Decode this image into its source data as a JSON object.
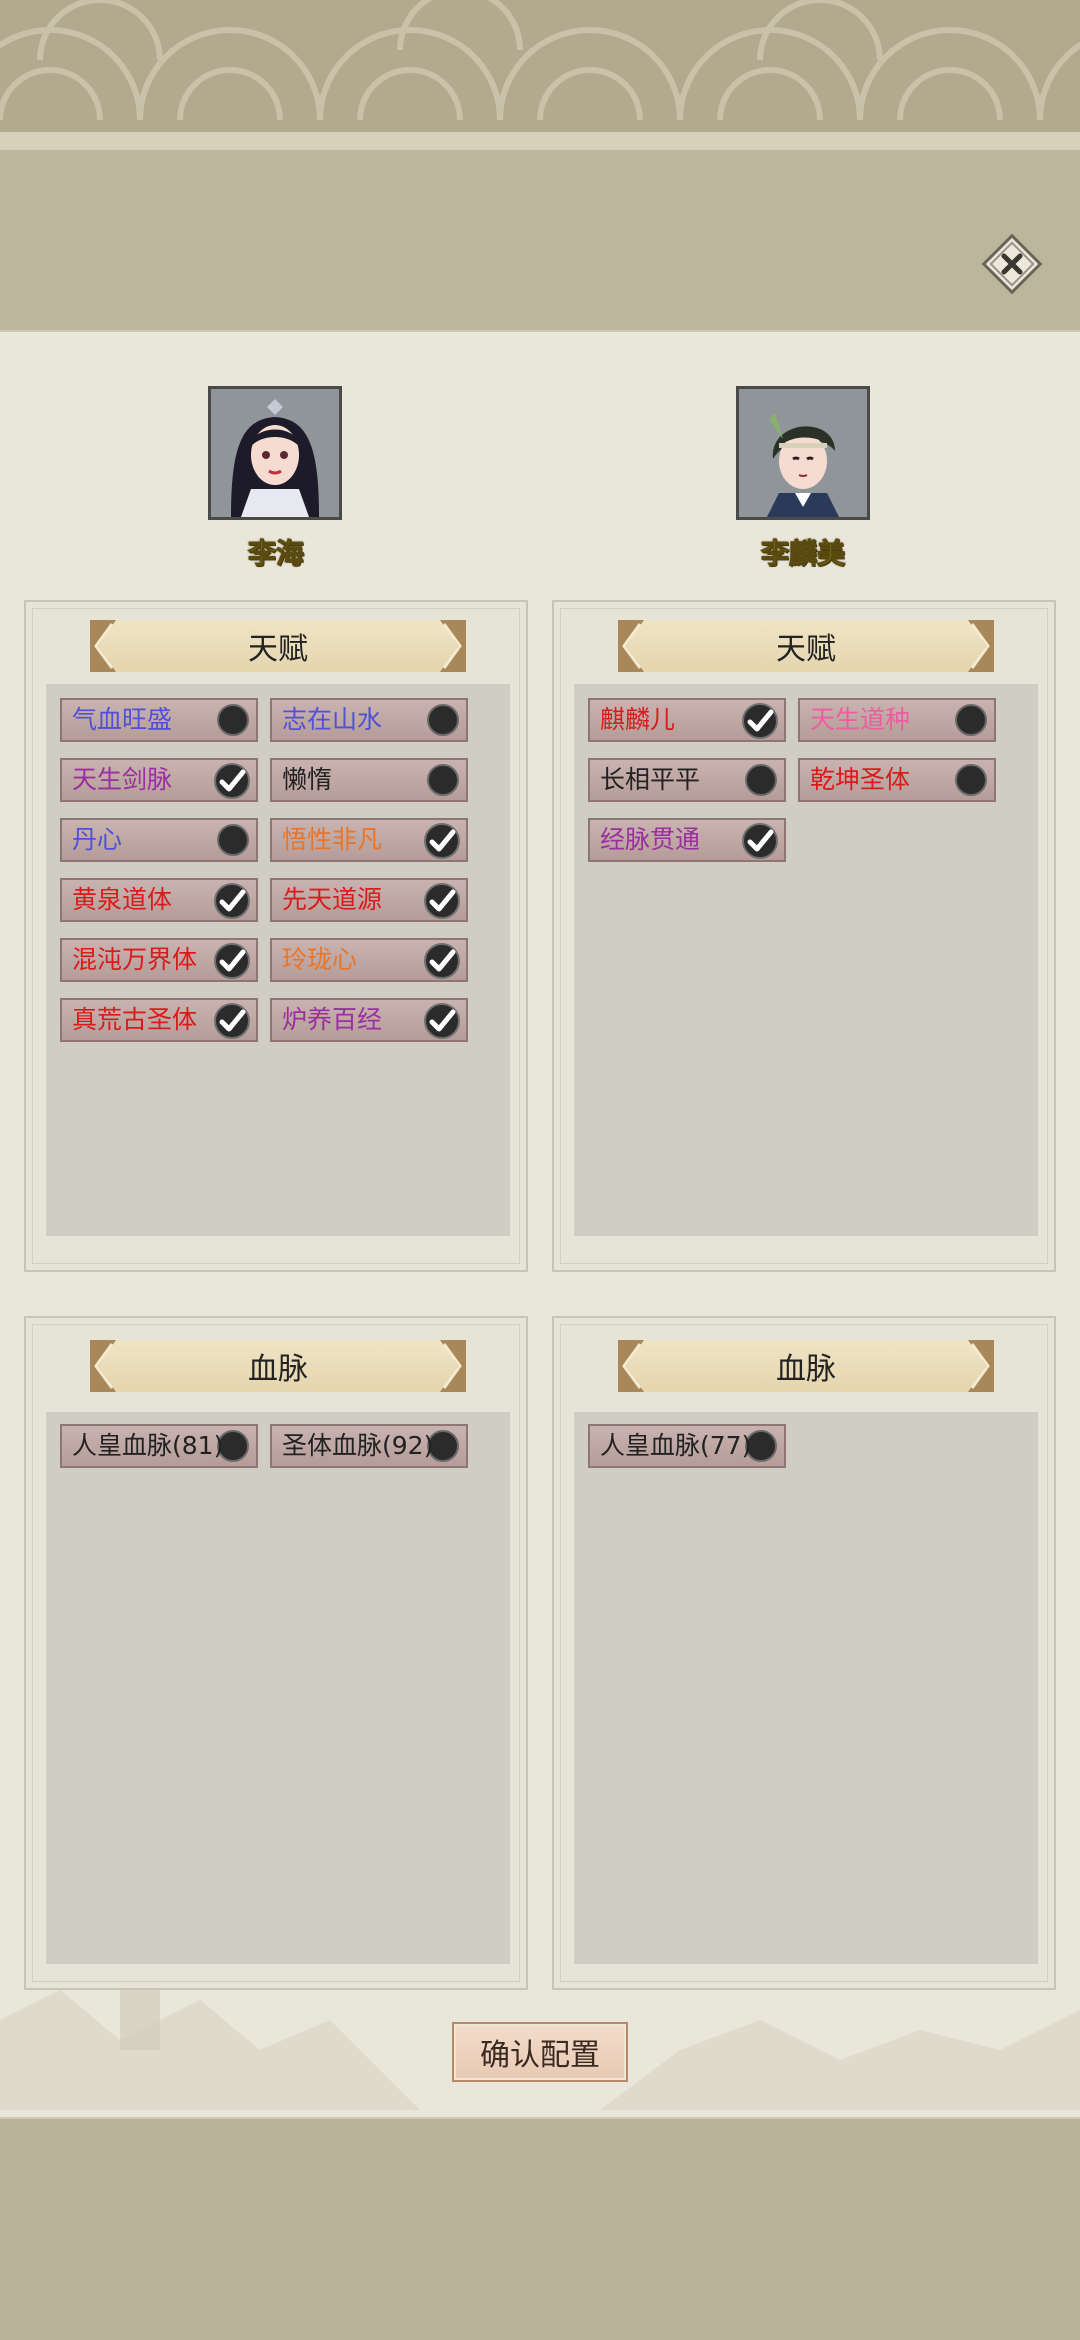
{
  "characters": [
    {
      "name": "李海"
    },
    {
      "name": "李麟美"
    }
  ],
  "panels": {
    "talent_title": "天赋",
    "bloodline_title": "血脉"
  },
  "left_talents": [
    {
      "label": "气血旺盛",
      "color": "#5050d8",
      "checked": false
    },
    {
      "label": "志在山水",
      "color": "#5050d8",
      "checked": false
    },
    {
      "label": "天生剑脉",
      "color": "#9a2fa0",
      "checked": true
    },
    {
      "label": "懒惰",
      "color": "#222222",
      "checked": false
    },
    {
      "label": "丹心",
      "color": "#5050d8",
      "checked": false
    },
    {
      "label": "悟性非凡",
      "color": "#e8762a",
      "checked": true
    },
    {
      "label": "黄泉道体",
      "color": "#d81c1c",
      "checked": true
    },
    {
      "label": "先天道源",
      "color": "#d81c1c",
      "checked": true
    },
    {
      "label": "混沌万界体",
      "color": "#d81c1c",
      "checked": true
    },
    {
      "label": "玲珑心",
      "color": "#e8762a",
      "checked": true
    },
    {
      "label": "真荒古圣体",
      "color": "#d81c1c",
      "checked": true
    },
    {
      "label": "炉养百经",
      "color": "#9a2fa0",
      "checked": true
    }
  ],
  "right_talents": [
    {
      "label": "麒麟儿",
      "color": "#d81c1c",
      "checked": true
    },
    {
      "label": "天生道种",
      "color": "#ee5da0",
      "checked": false
    },
    {
      "label": "长相平平",
      "color": "#222222",
      "checked": false
    },
    {
      "label": "乾坤圣体",
      "color": "#d81c1c",
      "checked": false
    },
    {
      "label": "经脉贯通",
      "color": "#9a2fa0",
      "checked": true
    }
  ],
  "left_bloodlines": [
    {
      "label": "人皇血脉(81)",
      "color": "#222222",
      "checked": false
    },
    {
      "label": "圣体血脉(92)",
      "color": "#222222",
      "checked": false
    }
  ],
  "right_bloodlines": [
    {
      "label": "人皇血脉(77)",
      "color": "#222222",
      "checked": false
    }
  ],
  "confirm_label": "确认配置",
  "icons": {
    "close": "close-icon",
    "check": "checkmark-icon",
    "empty": "empty-dot-icon",
    "arrow_left": "chevron-left-icon",
    "arrow_right": "chevron-right-icon"
  }
}
